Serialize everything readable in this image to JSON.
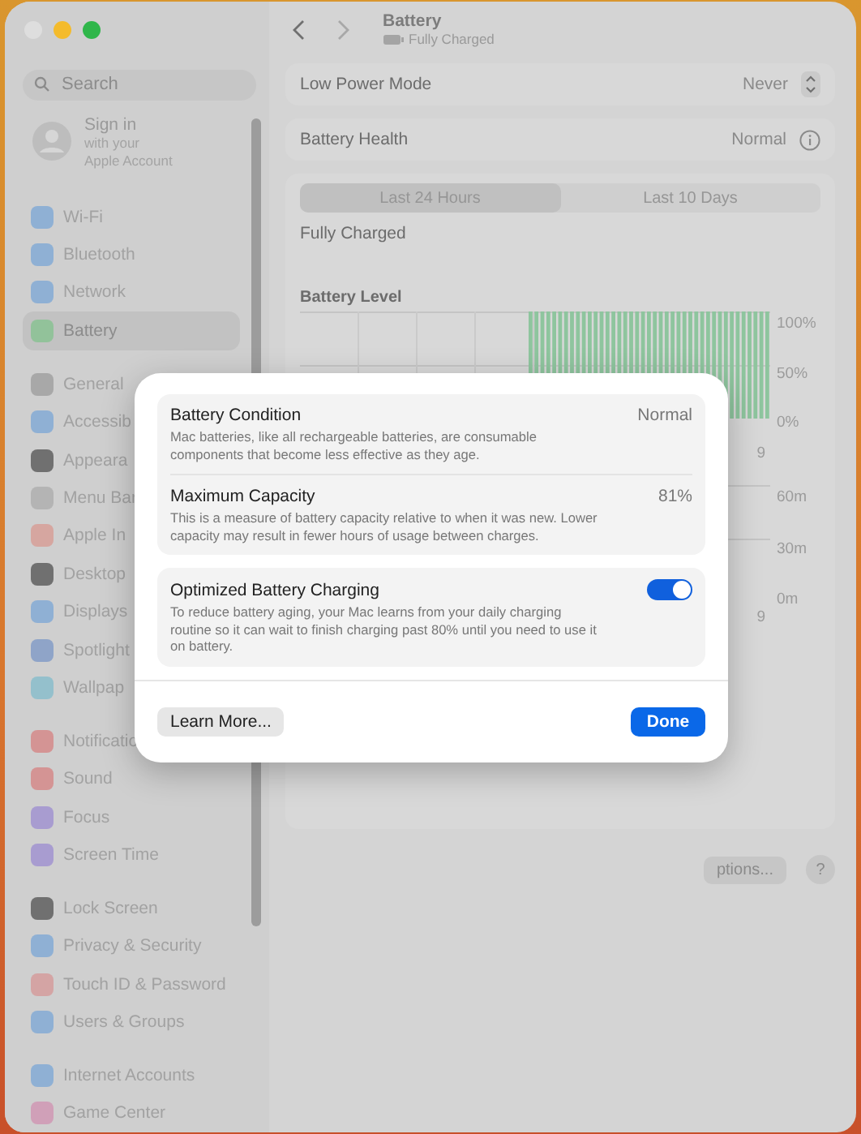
{
  "window": {
    "title": "Battery",
    "subtitle": "Fully Charged"
  },
  "search": {
    "placeholder": "Search"
  },
  "account": {
    "title": "Sign in",
    "line_1": "with your",
    "line_2": "Apple Account"
  },
  "sidebar": {
    "groups": [
      {
        "items": [
          {
            "label": "Wi-Fi",
            "color": "#8fb0d4",
            "selected": false
          },
          {
            "label": "Bluetooth",
            "color": "#8fb0d4",
            "selected": false
          },
          {
            "label": "Network",
            "color": "#8fb0d4",
            "selected": false
          },
          {
            "label": "Battery",
            "color": "#92c29a",
            "selected": true
          }
        ]
      },
      {
        "items": [
          {
            "label": "General",
            "color": "#a8a8a8",
            "selected": false
          },
          {
            "label": "Accessib",
            "color": "#8fb0d4",
            "selected": false
          },
          {
            "label": "Appeara",
            "color": "#707070",
            "selected": false
          },
          {
            "label": "Menu Bar",
            "color": "#b4b4b4",
            "selected": false
          },
          {
            "label": "Apple In",
            "color": "#d6a6a0",
            "selected": false
          },
          {
            "label": "Desktop",
            "color": "#707070",
            "selected": false
          },
          {
            "label": "Displays",
            "color": "#8fb0d4",
            "selected": false
          },
          {
            "label": "Spotlight",
            "color": "#8fa4c8",
            "selected": false
          },
          {
            "label": "Wallpap",
            "color": "#94c0cc",
            "selected": false
          }
        ]
      },
      {
        "items": [
          {
            "label": "Notificatio",
            "color": "#d49494",
            "selected": false
          },
          {
            "label": "Sound",
            "color": "#d49494",
            "selected": false
          },
          {
            "label": "Focus",
            "color": "#a89cd0",
            "selected": false
          },
          {
            "label": "Screen Time",
            "color": "#a89cd0",
            "selected": false
          }
        ]
      },
      {
        "items": [
          {
            "label": "Lock Screen",
            "color": "#707070",
            "selected": false
          },
          {
            "label": "Privacy & Security",
            "color": "#8fb0d4",
            "selected": false
          },
          {
            "label": "Touch ID & Password",
            "color": "#d4a4a4",
            "selected": false
          },
          {
            "label": "Users & Groups",
            "color": "#8fb0d4",
            "selected": false
          }
        ]
      },
      {
        "items": [
          {
            "label": "Internet Accounts",
            "color": "#8fb0d4",
            "selected": false
          },
          {
            "label": "Game Center",
            "color": "#d0a0b8",
            "selected": false
          }
        ]
      }
    ]
  },
  "settings": [
    {
      "label": "Low Power Mode",
      "kind": "popup",
      "value": "Never"
    },
    {
      "label": "Battery Health",
      "kind": "info",
      "value": "Normal"
    }
  ],
  "tabs": [
    {
      "label": "Last 24 Hours",
      "selected": true
    },
    {
      "label": "Last 10 Days",
      "selected": false
    }
  ],
  "status": "Fully Charged",
  "level_chart": {
    "title": "Battery Level",
    "y_labels": [
      "100%",
      "50%",
      "0%"
    ],
    "x_label_end": "9"
  },
  "usage_chart": {
    "y_labels": [
      "60m",
      "30m",
      "0m"
    ],
    "x_label_end": "9"
  },
  "footer": {
    "options_button": "ptions...",
    "help_button": "?"
  },
  "dialog": {
    "sections": [
      {
        "rows": [
          {
            "kind": "value",
            "title": "Battery Condition",
            "value": "Normal",
            "description": "Mac batteries, like all rechargeable batteries, are consumable components that become less effective as they age."
          },
          {
            "kind": "value",
            "title": "Maximum Capacity",
            "value": "81%",
            "description": "This is a measure of battery capacity relative to when it was new. Lower capacity may result in fewer hours of usage between charges."
          }
        ]
      },
      {
        "rows": [
          {
            "kind": "toggle",
            "title": "Optimized Battery Charging",
            "on": true,
            "description": "To reduce battery aging, your Mac learns from your daily charging routine so it can wait to finish charging past 80% until you need to use it on battery."
          }
        ]
      }
    ],
    "secondary_button": "Learn More...",
    "primary_button": "Done"
  }
}
